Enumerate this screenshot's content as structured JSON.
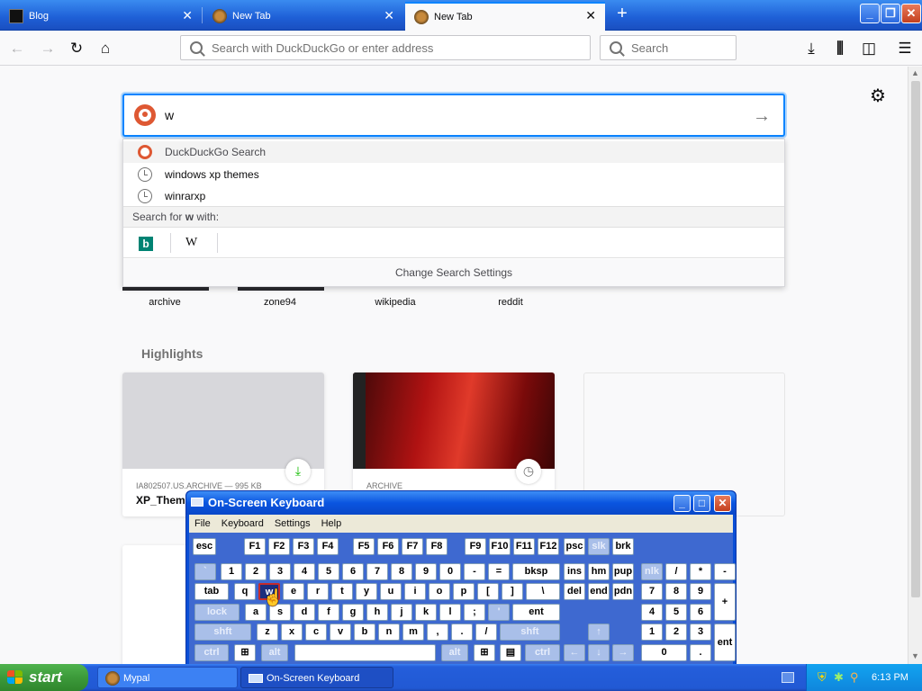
{
  "browser": {
    "tabs": [
      {
        "title": "Blog",
        "active": false
      },
      {
        "title": "New Tab",
        "active": false
      },
      {
        "title": "New Tab",
        "active": true
      }
    ],
    "url_placeholder": "Search with DuckDuckGo or enter address",
    "search_placeholder": "Search"
  },
  "newtab": {
    "search_query": "w",
    "suggestions": {
      "header": "DuckDuckGo Search",
      "items": [
        "windows xp themes",
        "winrarxp"
      ],
      "search_for_prefix": "Search for ",
      "search_for_term": "w",
      "search_for_suffix": " with:",
      "engines": [
        "Bing",
        "W"
      ],
      "change_settings": "Change Search Settings"
    },
    "topsites": [
      "archive",
      "zone94",
      "wikipedia",
      "reddit"
    ],
    "highlights_title": "Highlights",
    "highlights": [
      {
        "source": "IA802507.US.ARCHIVE — 995 KB",
        "title": "XP_Theme",
        "badge": "download-icon"
      },
      {
        "source": "ARCHIVE",
        "title": "",
        "badge": "clock-icon"
      }
    ]
  },
  "osk": {
    "title": "On-Screen Keyboard",
    "menu": [
      "File",
      "Keyboard",
      "Settings",
      "Help"
    ],
    "pressed_key": "w"
  },
  "taskbar": {
    "start": "start",
    "buttons": [
      "Mypal",
      "On-Screen Keyboard"
    ],
    "clock": "6:13 PM"
  },
  "colors": {
    "accent": "#0a84ff",
    "xp_blue": "#245edb",
    "start_green": "#3c9a3a"
  }
}
